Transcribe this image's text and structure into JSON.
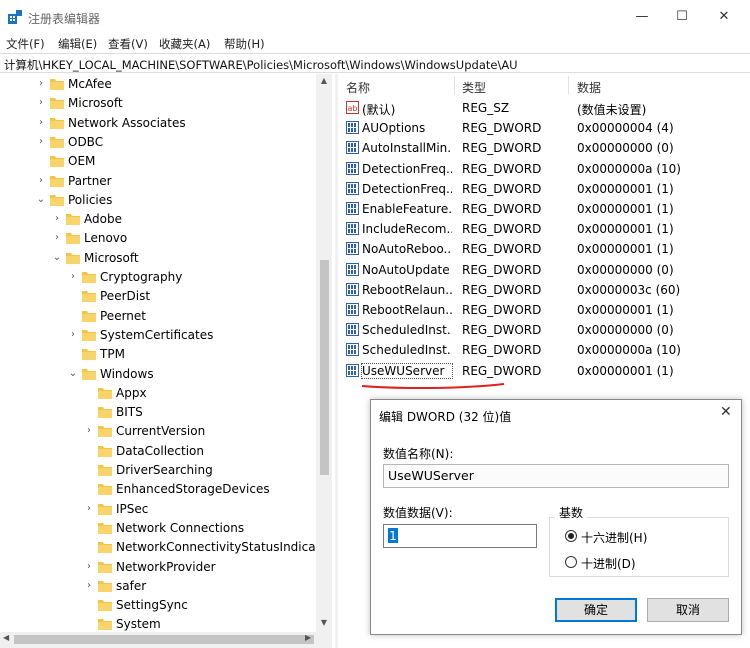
{
  "window": {
    "title": "注册表编辑器",
    "minimize": "—",
    "maximize": "☐",
    "close": "✕"
  },
  "menu": [
    "文件(F)",
    "编辑(E)",
    "查看(V)",
    "收藏夹(A)",
    "帮助(H)"
  ],
  "address": "计算机\\HKEY_LOCAL_MACHINE\\SOFTWARE\\Policies\\Microsoft\\Windows\\WindowsUpdate\\AU",
  "tree": [
    {
      "label": "McAfee",
      "level": 0,
      "chevron": ">"
    },
    {
      "label": "Microsoft",
      "level": 0,
      "chevron": ">"
    },
    {
      "label": "Network Associates",
      "level": 0,
      "chevron": ">"
    },
    {
      "label": "ODBC",
      "level": 0,
      "chevron": ">"
    },
    {
      "label": "OEM",
      "level": 0,
      "chevron": ""
    },
    {
      "label": "Partner",
      "level": 0,
      "chevron": ">"
    },
    {
      "label": "Policies",
      "level": 0,
      "chevron": "v"
    },
    {
      "label": "Adobe",
      "level": 1,
      "chevron": ">"
    },
    {
      "label": "Lenovo",
      "level": 1,
      "chevron": ">"
    },
    {
      "label": "Microsoft",
      "level": 1,
      "chevron": "v"
    },
    {
      "label": "Cryptography",
      "level": 2,
      "chevron": ">"
    },
    {
      "label": "PeerDist",
      "level": 2,
      "chevron": ""
    },
    {
      "label": "Peernet",
      "level": 2,
      "chevron": ""
    },
    {
      "label": "SystemCertificates",
      "level": 2,
      "chevron": ">"
    },
    {
      "label": "TPM",
      "level": 2,
      "chevron": ""
    },
    {
      "label": "Windows",
      "level": 2,
      "chevron": "v"
    },
    {
      "label": "Appx",
      "level": 3,
      "chevron": ""
    },
    {
      "label": "BITS",
      "level": 3,
      "chevron": ""
    },
    {
      "label": "CurrentVersion",
      "level": 3,
      "chevron": ">"
    },
    {
      "label": "DataCollection",
      "level": 3,
      "chevron": ""
    },
    {
      "label": "DriverSearching",
      "level": 3,
      "chevron": ""
    },
    {
      "label": "EnhancedStorageDevices",
      "level": 3,
      "chevron": ""
    },
    {
      "label": "IPSec",
      "level": 3,
      "chevron": ">"
    },
    {
      "label": "Network Connections",
      "level": 3,
      "chevron": ""
    },
    {
      "label": "NetworkConnectivityStatusIndicator",
      "level": 3,
      "chevron": ""
    },
    {
      "label": "NetworkProvider",
      "level": 3,
      "chevron": ">"
    },
    {
      "label": "safer",
      "level": 3,
      "chevron": ">"
    },
    {
      "label": "SettingSync",
      "level": 3,
      "chevron": ""
    },
    {
      "label": "System",
      "level": 3,
      "chevron": ""
    }
  ],
  "columns": {
    "name": "名称",
    "type": "类型",
    "data": "数据"
  },
  "values": [
    {
      "name": "(默认)",
      "type": "REG_SZ",
      "data": "(数值未设置)",
      "icon": "string-value-icon"
    },
    {
      "name": "AUOptions",
      "type": "REG_DWORD",
      "data": "0x00000004 (4)",
      "icon": "binary-value-icon"
    },
    {
      "name": "AutoInstallMin...",
      "type": "REG_DWORD",
      "data": "0x00000000 (0)",
      "icon": "binary-value-icon"
    },
    {
      "name": "DetectionFreq...",
      "type": "REG_DWORD",
      "data": "0x0000000a (10)",
      "icon": "binary-value-icon"
    },
    {
      "name": "DetectionFreq...",
      "type": "REG_DWORD",
      "data": "0x00000001 (1)",
      "icon": "binary-value-icon"
    },
    {
      "name": "EnableFeature...",
      "type": "REG_DWORD",
      "data": "0x00000001 (1)",
      "icon": "binary-value-icon"
    },
    {
      "name": "IncludeRecom...",
      "type": "REG_DWORD",
      "data": "0x00000001 (1)",
      "icon": "binary-value-icon"
    },
    {
      "name": "NoAutoReboo...",
      "type": "REG_DWORD",
      "data": "0x00000001 (1)",
      "icon": "binary-value-icon"
    },
    {
      "name": "NoAutoUpdate",
      "type": "REG_DWORD",
      "data": "0x00000000 (0)",
      "icon": "binary-value-icon"
    },
    {
      "name": "RebootRelaun...",
      "type": "REG_DWORD",
      "data": "0x0000003c (60)",
      "icon": "binary-value-icon"
    },
    {
      "name": "RebootRelaun...",
      "type": "REG_DWORD",
      "data": "0x00000001 (1)",
      "icon": "binary-value-icon"
    },
    {
      "name": "ScheduledInst...",
      "type": "REG_DWORD",
      "data": "0x00000000 (0)",
      "icon": "binary-value-icon"
    },
    {
      "name": "ScheduledInst...",
      "type": "REG_DWORD",
      "data": "0x0000000a (10)",
      "icon": "binary-value-icon"
    },
    {
      "name": "UseWUServer",
      "type": "REG_DWORD",
      "data": "0x00000001 (1)",
      "icon": "binary-value-icon"
    }
  ],
  "dialog": {
    "title": "编辑 DWORD (32 位)值",
    "close": "✕",
    "name_label": "数值名称(N):",
    "name_value": "UseWUServer",
    "data_label": "数值数据(V):",
    "data_value": "1",
    "base_label": "基数",
    "hex_label": "十六进制(H)",
    "dec_label": "十进制(D)",
    "base_selected": "hex",
    "ok": "确定",
    "cancel": "取消"
  },
  "colors": {
    "folder": "#f4c542",
    "accent": "#0078d7",
    "annotation": "#e02020"
  }
}
